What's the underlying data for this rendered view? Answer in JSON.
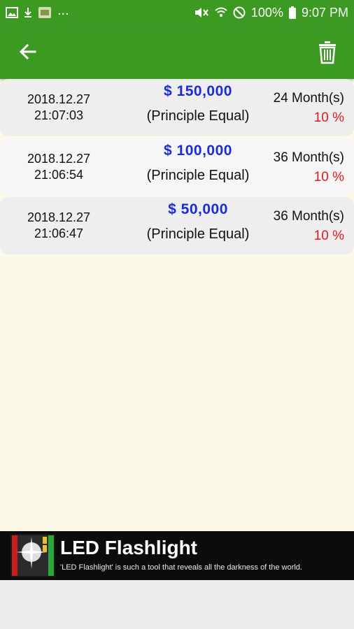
{
  "status_bar": {
    "battery_percent": "100%",
    "time": "9:07 PM",
    "overflow": "...",
    "icons": [
      "image-icon",
      "download-icon",
      "app-icon",
      "mute-icon",
      "wifi-icon",
      "do-not-disturb-icon",
      "battery-icon"
    ]
  },
  "app_bar": {
    "back_icon": "arrow-left-icon",
    "delete_icon": "trash-icon",
    "color": "#3c9a23"
  },
  "history": [
    {
      "date": "2018.12.27",
      "time": "21:07:03",
      "amount": "$ 150,000",
      "method": "(Principle Equal)",
      "term": "24 Month(s)",
      "rate": "10 %"
    },
    {
      "date": "2018.12.27",
      "time": "21:06:54",
      "amount": "$ 100,000",
      "method": "(Principle Equal)",
      "term": "36 Month(s)",
      "rate": "10 %"
    },
    {
      "date": "2018.12.27",
      "time": "21:06:47",
      "amount": "$ 50,000",
      "method": "(Principle Equal)",
      "term": "36 Month(s)",
      "rate": "10 %"
    }
  ],
  "ad": {
    "title": "LED Flashlight",
    "subtitle": "'LED Flashlight' is such a tool that reveals all the darkness of the world."
  },
  "colors": {
    "amount": "#1a2cd8",
    "rate": "#e11a1a",
    "background": "#fdf9e9"
  }
}
